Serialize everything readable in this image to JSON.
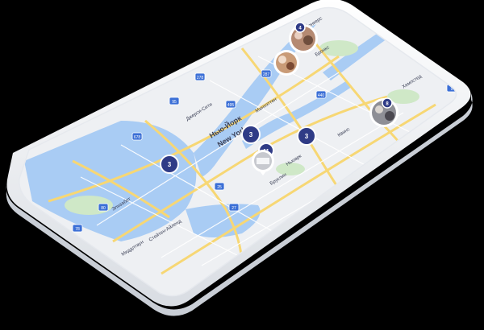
{
  "colors": {
    "background": "#000000",
    "phone_body": "#ffffff",
    "water": "#a9ccf4",
    "land": "#eef0f3",
    "park": "#cfe8c7",
    "highway": "#f7d774",
    "cluster": "#2f3b86"
  },
  "map": {
    "labels": [
      {
        "text": "Нью-Йорк",
        "role": "city-label"
      },
      {
        "text": "New York",
        "role": "city-label-en"
      },
      {
        "text": "Манхэттен",
        "role": "district-label"
      },
      {
        "text": "Бруклин",
        "role": "district-label"
      },
      {
        "text": "Квинс",
        "role": "district-label"
      },
      {
        "text": "Бронкс",
        "role": "district-label"
      },
      {
        "text": "Ньюарк",
        "role": "district-label"
      },
      {
        "text": "Джерси-Сити",
        "role": "district-label"
      },
      {
        "text": "Йонкерс",
        "role": "district-label"
      },
      {
        "text": "Хемпстед",
        "role": "district-label"
      },
      {
        "text": "Элизабет",
        "role": "district-label"
      },
      {
        "text": "Стейтен-Айленд",
        "role": "district-label"
      },
      {
        "text": "Миддлтаун",
        "role": "district-label"
      }
    ],
    "shields": [
      "95",
      "278",
      "495",
      "678",
      "80",
      "78",
      "287",
      "440",
      "25",
      "27",
      "9"
    ],
    "clusters": [
      {
        "count": "3",
        "name": "cluster-manhattan"
      },
      {
        "count": "3",
        "name": "cluster-queens"
      },
      {
        "count": "3",
        "name": "cluster-jersey"
      },
      {
        "count": "11",
        "name": "cluster-brooklyn"
      }
    ],
    "photo_pins": [
      {
        "name": "photo-pin-north-1",
        "badge": "4"
      },
      {
        "name": "photo-pin-north-2",
        "badge": ""
      },
      {
        "name": "photo-pin-east",
        "badge": "8"
      },
      {
        "name": "photo-pin-south",
        "badge": ""
      }
    ]
  }
}
